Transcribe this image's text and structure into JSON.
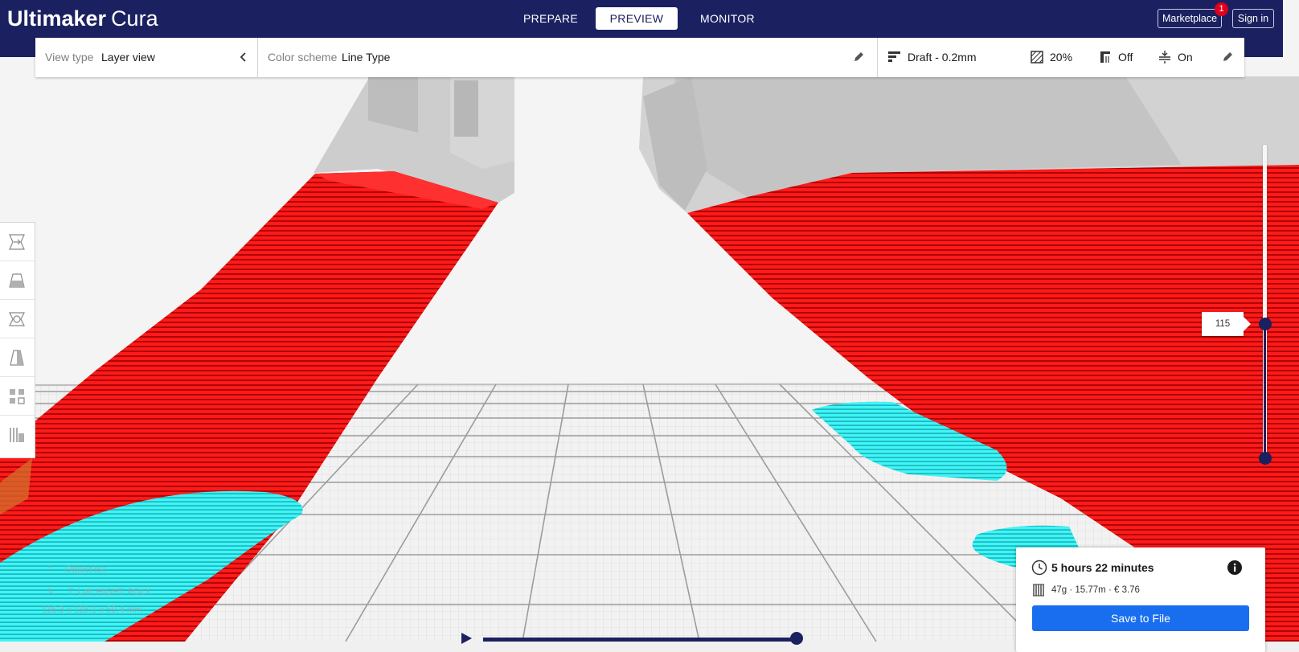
{
  "app": {
    "brand": "Ultimaker",
    "product": "Cura"
  },
  "header": {
    "stages": [
      {
        "label": "PREPARE",
        "active": false
      },
      {
        "label": "PREVIEW",
        "active": true
      },
      {
        "label": "MONITOR",
        "active": false
      }
    ],
    "marketplace_label": "Marketplace",
    "marketplace_badge": "1",
    "signin_label": "Sign in"
  },
  "view_settings": {
    "view_type_label": "View type",
    "view_type_value": "Layer view",
    "color_scheme_label": "Color scheme",
    "color_scheme_value": "Line Type"
  },
  "print_settings": {
    "profile": "Draft - 0.2mm",
    "infill": "20%",
    "support": "Off",
    "adhesion": "On"
  },
  "tools": [
    "move-tool",
    "scale-tool",
    "rotate-tool",
    "mirror-tool",
    "per-model-settings-tool",
    "support-blocker-tool"
  ],
  "layer_slider": {
    "current_layer": "115",
    "upper_fraction": 0.43,
    "lower_fraction": 0.0
  },
  "object_list": {
    "header": "Object list",
    "file_name": "T. Left HIGHT POLY",
    "dimensions": "116.3 x 118.1 x 59.4 mm"
  },
  "print_info": {
    "time": "5 hours 22 minutes",
    "material": "47g · 15.77m · € 3.76",
    "save_label": "Save to File"
  },
  "colors": {
    "header_bg": "#1b2160",
    "wall": "#ff1a1a",
    "skin": "#33ffff",
    "accent": "#196ef0"
  },
  "icons": [
    "clock-icon",
    "info-icon",
    "spool-icon",
    "chevron-left-icon",
    "pencil-icon",
    "profile-icon",
    "infill-icon",
    "support-icon",
    "adhesion-icon",
    "play-icon"
  ]
}
